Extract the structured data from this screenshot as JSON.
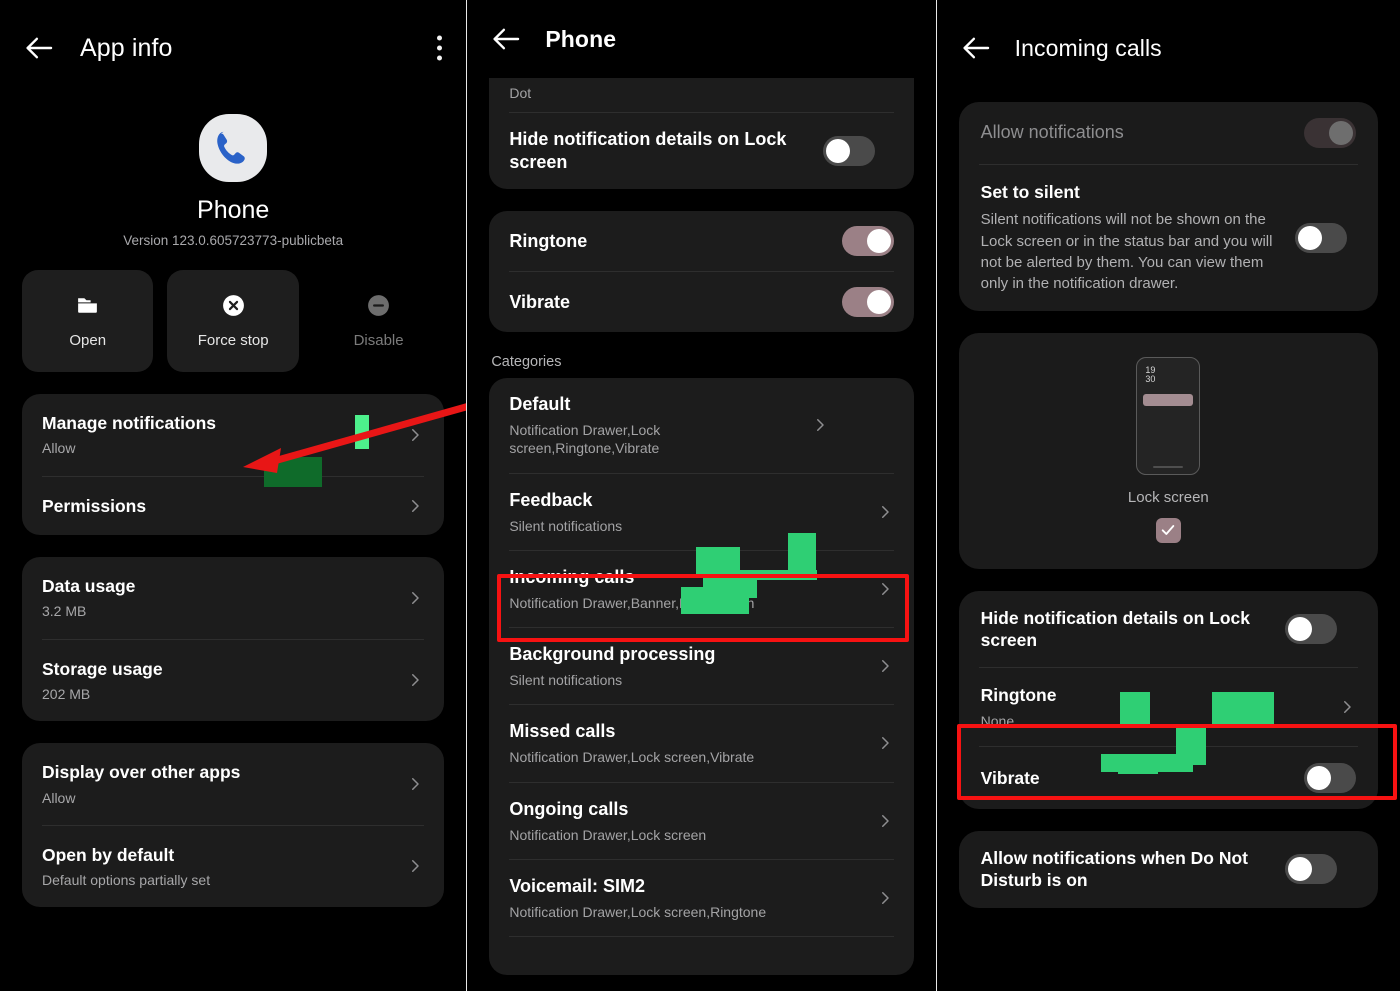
{
  "panel1": {
    "header": {
      "title": "App info",
      "back_icon": "arrow-left-icon",
      "menu_icon": "kebab-menu-icon"
    },
    "app": {
      "icon": "phone-app-icon",
      "name": "Phone",
      "version": "Version 123.0.605723773-publicbeta"
    },
    "actions": [
      {
        "label": "Open",
        "icon": "folder-open-icon",
        "enabled": true
      },
      {
        "label": "Force stop",
        "icon": "x-circle-icon",
        "enabled": true
      },
      {
        "label": "Disable",
        "icon": "minus-circle-icon",
        "enabled": false
      }
    ],
    "group_notifications": [
      {
        "title": "Manage notifications",
        "sub": "Allow",
        "chevron": "chevron-right-icon"
      },
      {
        "title": "Permissions",
        "sub": "",
        "chevron": "chevron-right-icon"
      }
    ],
    "group_usage": [
      {
        "title": "Data usage",
        "sub": "3.2 MB",
        "chevron": "chevron-right-icon"
      },
      {
        "title": "Storage usage",
        "sub": "202 MB",
        "chevron": "chevron-right-icon"
      }
    ],
    "group_defaults": [
      {
        "title": "Display over other apps",
        "sub": "Allow",
        "chevron": "chevron-right-icon"
      },
      {
        "title": "Open by default",
        "sub": "Default options partially set",
        "chevron": "chevron-right-icon"
      }
    ]
  },
  "panel2": {
    "header": {
      "title": "Phone",
      "back_icon": "arrow-left-icon"
    },
    "top_card": {
      "partial_label": "Dot",
      "hide_details": {
        "title": "Hide notification details on Lock screen",
        "state": "off"
      }
    },
    "sound_card": [
      {
        "title": "Ringtone",
        "state": "on"
      },
      {
        "title": "Vibrate",
        "state": "on"
      }
    ],
    "categories_label": "Categories",
    "categories": [
      {
        "title": "Default",
        "sub": "Notification Drawer,Lock screen,Ringtone,Vibrate",
        "highlighted": false
      },
      {
        "title": "Feedback",
        "sub": "Silent notifications",
        "highlighted": false
      },
      {
        "title": "Incoming calls",
        "sub": "Notification Drawer,Banner,Lock screen",
        "highlighted": true
      },
      {
        "title": "Background processing",
        "sub": "Silent notifications",
        "highlighted": false
      },
      {
        "title": "Missed calls",
        "sub": "Notification Drawer,Lock screen,Vibrate",
        "highlighted": false
      },
      {
        "title": "Ongoing calls",
        "sub": "Notification Drawer,Lock screen",
        "highlighted": false
      },
      {
        "title": "Voicemail: SIM2",
        "sub": "Notification Drawer,Lock screen,Ringtone",
        "highlighted": false
      }
    ]
  },
  "panel3": {
    "header": {
      "title": "Incoming calls",
      "back_icon": "arrow-left-icon"
    },
    "allow": {
      "title": "Allow notifications",
      "state": "on-disabled"
    },
    "silent": {
      "title": "Set to silent",
      "description": "Silent notifications will not be shown on the Lock screen or in the status bar and you will not be alerted by them. You can view them only in the notification drawer.",
      "state": "off"
    },
    "preview": {
      "mock_time": "19\n30",
      "label": "Lock screen",
      "checked": true,
      "check_icon": "checkmark-icon"
    },
    "options_card": [
      {
        "title": "Hide notification details on Lock screen",
        "kind": "toggle",
        "state": "off",
        "highlighted": false
      },
      {
        "title": "Ringtone",
        "sub": "None",
        "kind": "chevron",
        "highlighted": true
      },
      {
        "title": "Vibrate",
        "kind": "toggle",
        "state": "off",
        "highlighted": false
      }
    ],
    "dnd_card": [
      {
        "title": "Allow notifications when Do Not Disturb is on",
        "kind": "toggle",
        "state": "off"
      }
    ]
  },
  "annotations": {
    "arrow_color": "#e81616",
    "box_color": "#f71212",
    "highlight_color": "#4df08c"
  }
}
